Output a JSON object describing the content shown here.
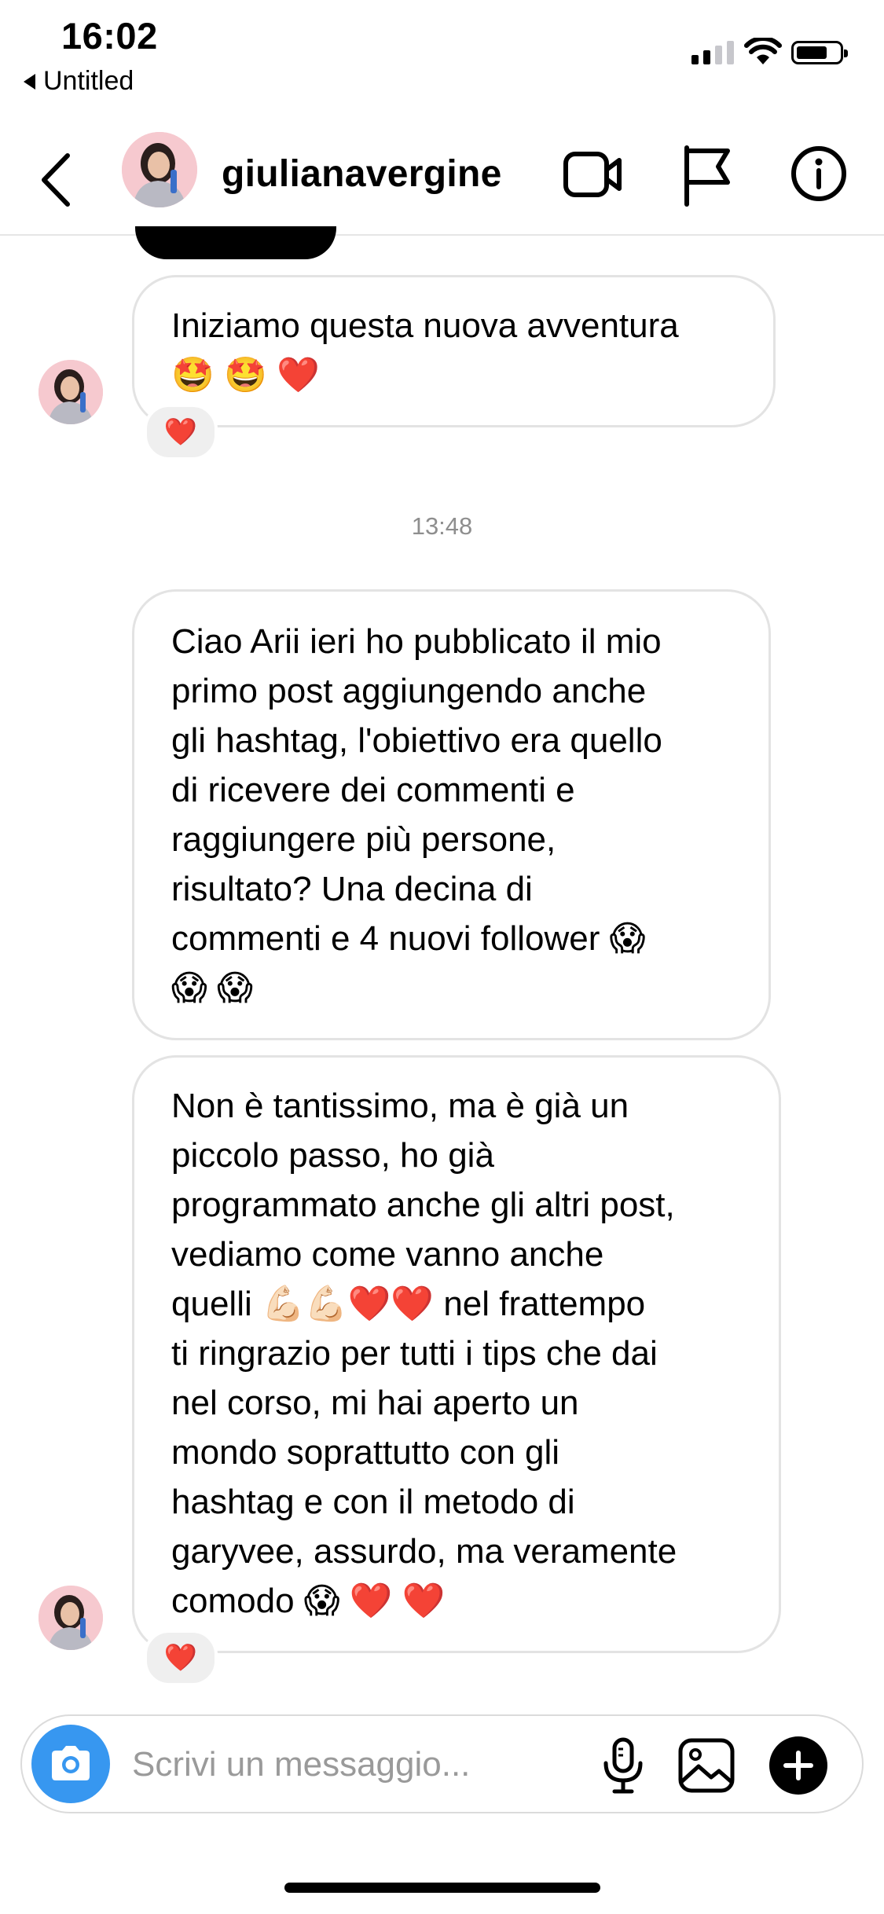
{
  "status_bar": {
    "time": "16:02",
    "back_app": "Untitled",
    "signal_bars_active": 2,
    "signal_bars_total": 4,
    "battery_level": 0.7
  },
  "header": {
    "username": "giulianavergine",
    "back_icon": "chevron-left-icon",
    "video_icon": "video-camera-icon",
    "flag_icon": "flag-icon",
    "info_icon": "info-icon"
  },
  "conversation": {
    "messages": [
      {
        "id": "m1",
        "text": "Iniziamo questa nuova avventura\n🤩 🤩 ❤️",
        "reaction": "❤️"
      },
      {
        "id": "m2",
        "text": "Ciao Arii ieri ho pubblicato il mio\nprimo post aggiungendo anche\ngli hashtag, l'obiettivo era quello\ndi ricevere dei commenti e\nraggiungere più persone,\nrisultato? Una decina di\ncommenti e 4 nuovi follower 😱\n😱 😱"
      },
      {
        "id": "m3",
        "text": "Non è tantissimo, ma è già un\npiccolo passo, ho già\nprogrammato anche gli altri post,\nvediamo come vanno anche\nquelli 💪🏻💪🏻❤️❤️ nel frattempo\nti ringrazio per tutti i tips che dai\nnel corso, mi hai aperto un\nmondo soprattutto con gli\nhashtag e con il metodo di\ngaryvee, assurdo, ma veramente\ncomodo 😱 ❤️ ❤️",
        "reaction": "❤️"
      }
    ],
    "timestamp": "13:48"
  },
  "composer": {
    "placeholder": "Scrivi un messaggio...",
    "value": "",
    "camera_icon": "camera-icon",
    "mic_icon": "microphone-icon",
    "gallery_icon": "image-gallery-icon",
    "plus_icon": "plus-icon"
  },
  "colors": {
    "accent": "#3797f0",
    "bubble_border": "#e3e3e3",
    "reaction_bg": "#efefef",
    "timestamp": "#8e8e8e",
    "avatar_bg": "#f6c9cf"
  }
}
